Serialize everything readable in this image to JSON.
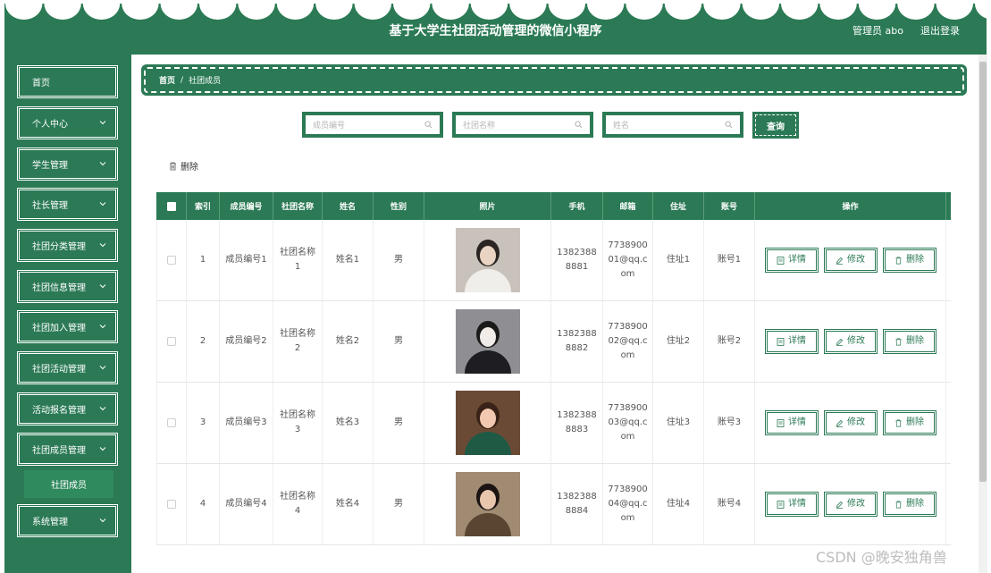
{
  "header": {
    "title": "基于大学生社团活动管理的微信小程序",
    "admin_label": "管理员 abo",
    "logout_label": "退出登录"
  },
  "sidebar": {
    "items": [
      {
        "label": "首页",
        "has_chevron": false
      },
      {
        "label": "个人中心",
        "has_chevron": true
      },
      {
        "label": "学生管理",
        "has_chevron": true
      },
      {
        "label": "社长管理",
        "has_chevron": true
      },
      {
        "label": "社团分类管理",
        "has_chevron": true
      },
      {
        "label": "社团信息管理",
        "has_chevron": true
      },
      {
        "label": "社团加入管理",
        "has_chevron": true
      },
      {
        "label": "社团活动管理",
        "has_chevron": true
      },
      {
        "label": "活动报名管理",
        "has_chevron": true
      },
      {
        "label": "社团成员管理",
        "has_chevron": true
      }
    ],
    "sub_item": "社团成员",
    "last_item": "系统管理"
  },
  "breadcrumb": {
    "home": "首页",
    "separator": "/",
    "current": "社团成员"
  },
  "search": {
    "member_code_placeholder": "成员编号",
    "club_name_placeholder": "社团名称",
    "name_placeholder": "姓名",
    "query_label": "查询"
  },
  "bulk_delete_label": "删除",
  "table": {
    "headers": [
      "索引",
      "成员编号",
      "社团名称",
      "姓名",
      "性别",
      "照片",
      "手机",
      "邮箱",
      "住址",
      "账号",
      "操作"
    ],
    "rows": [
      {
        "index": "1",
        "code": "成员编号1",
        "club": "社团名称1",
        "name": "姓名1",
        "sex": "男",
        "phone": "13823888881",
        "email": "773890001@qq.com",
        "addr": "住址1",
        "acct": "账号1"
      },
      {
        "index": "2",
        "code": "成员编号2",
        "club": "社团名称2",
        "name": "姓名2",
        "sex": "男",
        "phone": "13823888882",
        "email": "773890002@qq.com",
        "addr": "住址2",
        "acct": "账号2"
      },
      {
        "index": "3",
        "code": "成员编号3",
        "club": "社团名称3",
        "name": "姓名3",
        "sex": "男",
        "phone": "13823888883",
        "email": "773890003@qq.com",
        "addr": "住址3",
        "acct": "账号3"
      },
      {
        "index": "4",
        "code": "成员编号4",
        "club": "社团名称4",
        "name": "姓名4",
        "sex": "男",
        "phone": "13823888884",
        "email": "773890004@qq.com",
        "addr": "住址4",
        "acct": "账号4"
      }
    ],
    "actions": {
      "detail": "详情",
      "edit": "修改",
      "delete": "删除"
    }
  },
  "colors": {
    "brand": "#2b7a55"
  },
  "watermark": "CSDN @晚安独角兽"
}
